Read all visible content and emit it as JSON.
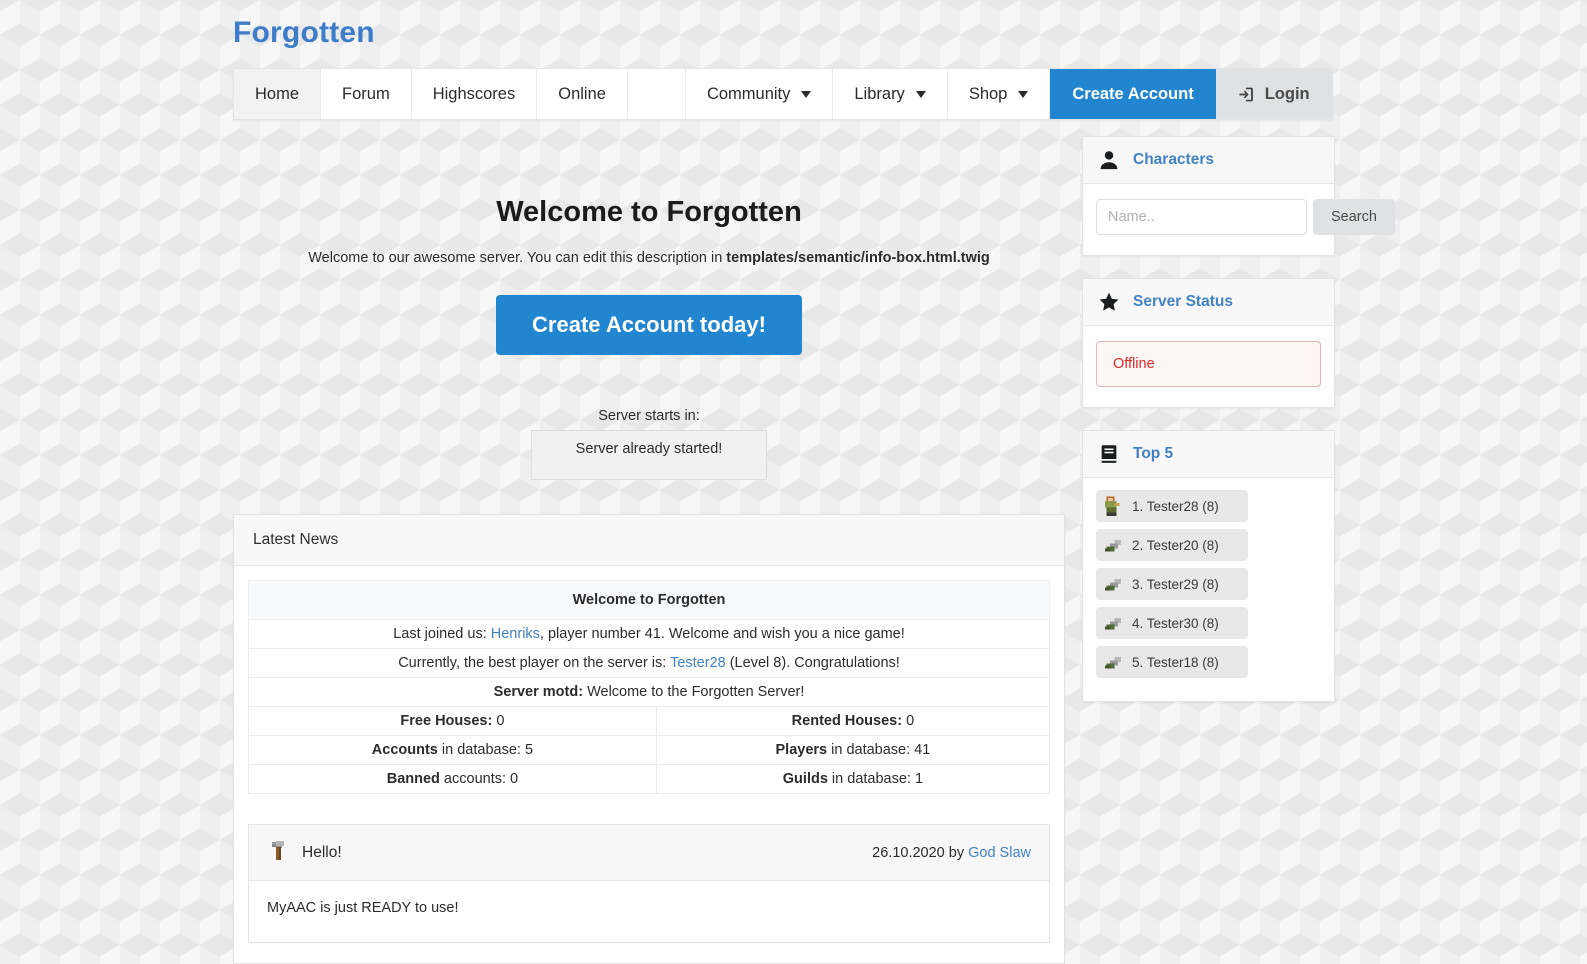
{
  "site": {
    "logo": "Forgotten"
  },
  "nav": {
    "items": [
      {
        "label": "Home",
        "active": true,
        "caret": false
      },
      {
        "label": "Forum",
        "active": false,
        "caret": false
      },
      {
        "label": "Highscores",
        "active": false,
        "caret": false
      },
      {
        "label": "Online",
        "active": false,
        "caret": false
      },
      {
        "label": "",
        "active": false,
        "caret": false,
        "spacer": true
      },
      {
        "label": "Community",
        "active": false,
        "caret": true
      },
      {
        "label": "Library",
        "active": false,
        "caret": true
      },
      {
        "label": "Shop",
        "active": false,
        "caret": true
      }
    ],
    "create_account_label": "Create Account",
    "login_label": "Login",
    "login_icon": "sign-in-icon",
    "primary_color": "#2185d0",
    "secondary_color": "#e0e1e2"
  },
  "main": {
    "welcome_title": "Welcome to Forgotten",
    "welcome_text_prefix": "Welcome to our awesome server. You can edit this description in ",
    "welcome_text_path": "templates/semantic/info-box.html.twig",
    "cta_label": "Create Account today!",
    "server_starts_label": "Server starts in:",
    "server_starts_value": "Server already started!"
  },
  "news": {
    "panel_title": "Latest News",
    "info_header": "Welcome to Forgotten",
    "rows": [
      {
        "type": "full",
        "parts": [
          {
            "text": "Last joined us: ",
            "style": "plain"
          },
          {
            "text": "Henriks",
            "style": "link"
          },
          {
            "text": ", player number 41. Welcome and wish you a nice game!",
            "style": "plain"
          }
        ]
      },
      {
        "type": "full",
        "parts": [
          {
            "text": "Currently, the best player on the server is: ",
            "style": "plain"
          },
          {
            "text": "Tester28",
            "style": "link"
          },
          {
            "text": " (Level 8). Congratulations!",
            "style": "plain"
          }
        ]
      },
      {
        "type": "full",
        "parts": [
          {
            "text": "Server motd:",
            "style": "bold"
          },
          {
            "text": " Welcome to the Forgotten Server!",
            "style": "plain"
          }
        ]
      }
    ],
    "stats_pairs": [
      {
        "left_label": "Free Houses:",
        "left_value": " 0",
        "right_label": "Rented Houses:",
        "right_value": " 0"
      },
      {
        "left_label": "Accounts",
        "left_value": " in database: 5",
        "right_label": "Players",
        "right_value": " in database: 41"
      },
      {
        "left_label": "Banned",
        "left_value": " accounts: 0",
        "right_label": "Guilds",
        "right_value": " in database: 1"
      }
    ],
    "post": {
      "icon": "hammer-icon",
      "title": "Hello!",
      "date": "26.10.2020 by ",
      "author": "God Slaw",
      "body": "MyAAC is just READY to use!"
    }
  },
  "sidebar": {
    "characters": {
      "icon": "user-icon",
      "title": "Characters",
      "search_placeholder": "Name..",
      "search_value": "",
      "search_button": "Search"
    },
    "server_status": {
      "icon": "star-icon",
      "title": "Server Status",
      "status": "Offline",
      "status_color": "#db2828"
    },
    "top5": {
      "icon": "book-icon",
      "title": "Top 5",
      "entries": [
        {
          "label": "1. Tester28 (8)",
          "sprite": "character-outfit"
        },
        {
          "label": "2. Tester20 (8)",
          "sprite": "small-creature"
        },
        {
          "label": "3. Tester29 (8)",
          "sprite": "small-creature"
        },
        {
          "label": "4. Tester30 (8)",
          "sprite": "small-creature"
        },
        {
          "label": "5. Tester18 (8)",
          "sprite": "small-creature"
        }
      ]
    }
  }
}
